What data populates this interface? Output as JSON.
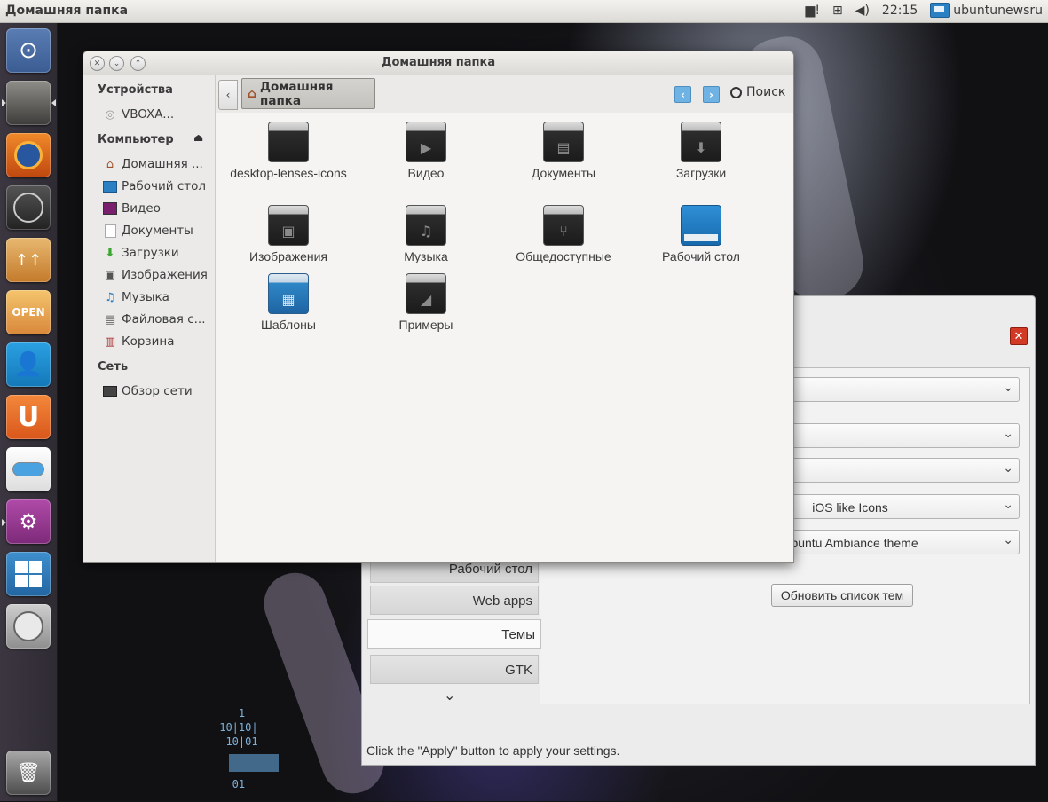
{
  "top_panel": {
    "title": "Домашняя папка",
    "clock": "22:15",
    "session_label": "ubuntunewsru",
    "indicators": [
      "message-icon",
      "network-icon",
      "volume-icon"
    ]
  },
  "launcher": {
    "items": [
      "dash-home-icon",
      "files-icon",
      "firefox-icon",
      "system-monitor-icon",
      "software-updater-icon",
      "market-icon",
      "contacts-icon",
      "ubuntu-one-icon",
      "toggle-icon",
      "unity-tweak-icon",
      "workspace-switcher-icon",
      "cd-drive-icon",
      "trash-icon"
    ]
  },
  "nautilus": {
    "window_title": "Домашняя папка",
    "sidebar": {
      "devices_header": "Устройства",
      "devices": [
        {
          "label": "VBOXA...",
          "icon": "cd-icon"
        }
      ],
      "computer_header": "Компьютер",
      "computer": [
        {
          "label": "Домашняя ...",
          "icon": "home-icon"
        },
        {
          "label": "Рабочий стол",
          "icon": "desktop-icon"
        },
        {
          "label": "Видео",
          "icon": "video-icon"
        },
        {
          "label": "Документы",
          "icon": "document-icon"
        },
        {
          "label": "Загрузки",
          "icon": "download-icon"
        },
        {
          "label": "Изображения",
          "icon": "image-icon"
        },
        {
          "label": "Музыка",
          "icon": "music-icon"
        },
        {
          "label": "Файловая с...",
          "icon": "filesystem-icon"
        },
        {
          "label": "Корзина",
          "icon": "trash-icon"
        }
      ],
      "network_header": "Сеть",
      "network": [
        {
          "label": "Обзор сети",
          "icon": "network-browse-icon"
        }
      ]
    },
    "toolbar": {
      "path_label": "Домашняя папка",
      "search_label": "Поиск"
    },
    "files": [
      {
        "label": "desktop-lenses-icons",
        "icon": "folder-icon"
      },
      {
        "label": "Видео",
        "icon": "folder-video-icon"
      },
      {
        "label": "Документы",
        "icon": "folder-documents-icon"
      },
      {
        "label": "Загрузки",
        "icon": "folder-downloads-icon"
      },
      {
        "label": "Изображения",
        "icon": "folder-pictures-icon"
      },
      {
        "label": "Музыка",
        "icon": "folder-music-icon"
      },
      {
        "label": "Общедоступные",
        "icon": "folder-public-icon"
      },
      {
        "label": "Рабочий стол",
        "icon": "folder-desktop-icon"
      },
      {
        "label": "Шаблоны",
        "icon": "folder-templates-icon"
      },
      {
        "label": "Примеры",
        "icon": "folder-examples-icon"
      }
    ]
  },
  "tweak": {
    "combos": [
      "",
      "",
      "",
      "iOS like Icons",
      "Ubuntu Ambiance theme"
    ],
    "refresh_button": "Обновить список тем",
    "tabs": [
      "Рабочий стол",
      "Web apps",
      "Темы",
      "GTK"
    ],
    "active_tab": "Темы",
    "status_text": "Click the \"Apply\" button to apply your settings."
  },
  "desktop": {
    "binary_text": "    1\n 10|10|\n  10|01\n\n\n   01"
  }
}
